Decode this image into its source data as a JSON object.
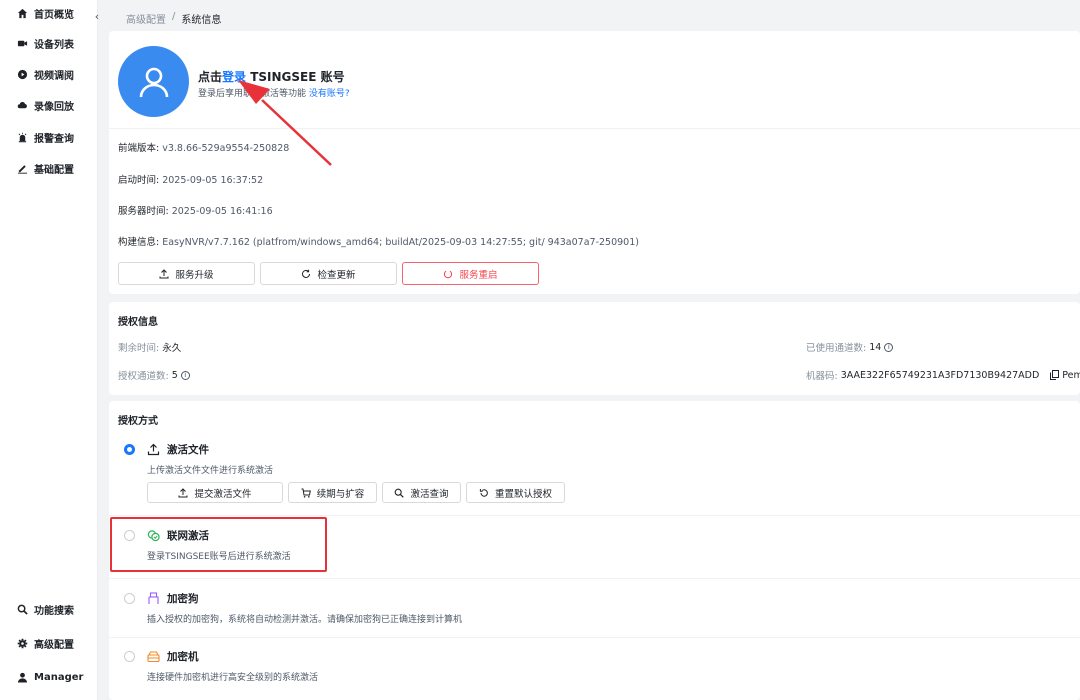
{
  "sidebar": {
    "top_items": [
      {
        "label": "首页概览",
        "icon": "home-icon"
      },
      {
        "label": "设备列表",
        "icon": "camera-icon"
      },
      {
        "label": "视频调阅",
        "icon": "play-icon"
      },
      {
        "label": "录像回放",
        "icon": "cloud-icon"
      },
      {
        "label": "报警查询",
        "icon": "alarm-icon"
      },
      {
        "label": "基础配置",
        "icon": "edit-icon"
      }
    ],
    "bottom_items": [
      {
        "label": "功能搜索",
        "icon": "search-icon"
      },
      {
        "label": "高级配置",
        "icon": "gear-icon"
      },
      {
        "label": "Manager",
        "icon": "user-icon"
      }
    ]
  },
  "breadcrumb": {
    "parent": "高级配置",
    "separator": "/",
    "current": "系统信息"
  },
  "account": {
    "title_prefix": "点击",
    "title_link": "登录",
    "title_suffix": " TSINGSEE 账号",
    "subtitle": "登录后享用联网激活等功能",
    "subtitle_link": "没有账号?"
  },
  "system_info": [
    {
      "label": "前端版本:",
      "value": " v3.8.66-529a9554-250828"
    },
    {
      "label": "启动时间:",
      "value": " 2025-09-05 16:37:52"
    },
    {
      "label": "服务器时间:",
      "value": " 2025-09-05 16:41:16"
    },
    {
      "label": "构建信息:",
      "value": " EasyNVR/v7.7.162 (platfrom/windows_amd64; buildAt/2025-09-03 14:27:55; git/ 943a07a7-250901)"
    }
  ],
  "actions": {
    "upgrade": "服务升级",
    "check_update": "检查更新",
    "restart": "服务重启"
  },
  "license": {
    "title": "授权信息",
    "remaining_label": "剩余时间:",
    "remaining_value": "永久",
    "channels_label": "授权通道数:",
    "channels_value": "5",
    "used_label": "已使用通道数:",
    "used_value": "14",
    "machine_label": "机器码:",
    "machine_value": "3AAE322F65749231A3FD7130B9427ADD",
    "pem_label": "Pem"
  },
  "methods": {
    "title": "授权方式",
    "file": {
      "title": "激活文件",
      "desc": "上传激活文件文件进行系统激活",
      "buttons": {
        "submit": "提交激活文件",
        "renew": "续期与扩容",
        "query": "激活查询",
        "reset": "重置默认授权"
      }
    },
    "online": {
      "title": "联网激活",
      "desc": "登录TSINGSEE账号后进行系统激活"
    },
    "dongle": {
      "title": "加密狗",
      "desc": "插入授权的加密狗，系统将自动检测并激活。请确保加密狗已正确连接到计算机"
    },
    "hsm": {
      "title": "加密机",
      "desc": "连接硬件加密机进行高安全级别的系统激活"
    }
  },
  "colors": {
    "primary": "#1677ff",
    "danger": "#f5464f",
    "avatar": "#3a8bf0",
    "annotation": "#e8323a"
  }
}
